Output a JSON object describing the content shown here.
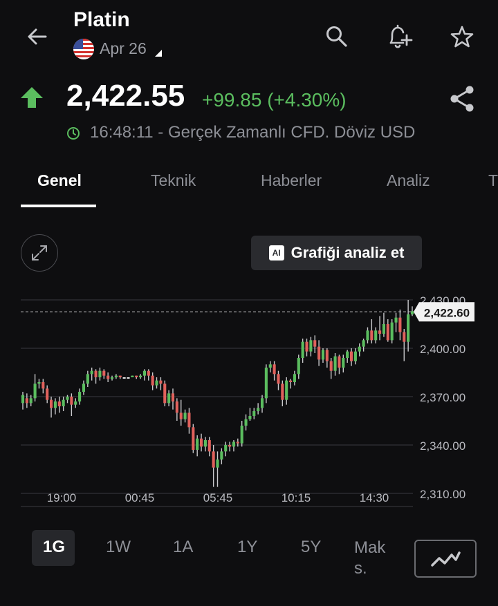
{
  "header": {
    "title": "Platin",
    "date": "Apr 26",
    "price": "2,422.55",
    "change": "+99.85 (+4.30%)",
    "time_status": "16:48:11 - Gerçek Zamanlı CFD. Döviz USD"
  },
  "icons": {
    "back": "back-arrow-icon",
    "search": "search-icon",
    "alert": "add-alert-bell-icon",
    "favorite": "star-icon",
    "share": "share-icon",
    "trend": "up-arrow-icon",
    "clock": "clock-icon",
    "flag": "us-flag-icon",
    "expand": "expand-icon",
    "chart_type": "line-chart-icon"
  },
  "colors": {
    "background": "#0e0e10",
    "up": "#5bbd5f",
    "down": "#e0615c",
    "muted": "#8d8f96"
  },
  "tabs": [
    {
      "label": "Genel",
      "active": true
    },
    {
      "label": "Teknik",
      "active": false
    },
    {
      "label": "Haberler",
      "active": false
    },
    {
      "label": "Analiz",
      "active": false
    },
    {
      "label": "T",
      "active": false
    }
  ],
  "analyze_button": {
    "badge": "AI",
    "label": "Grafiği analiz et"
  },
  "periods": [
    {
      "label": "1G",
      "active": true
    },
    {
      "label": "1W",
      "active": false
    },
    {
      "label": "1A",
      "active": false
    },
    {
      "label": "1Y",
      "active": false
    },
    {
      "label": "5Y",
      "active": false
    },
    {
      "label": "Mak s.",
      "active": false
    }
  ],
  "chart_data": {
    "type": "candlestick",
    "x_tick_labels": [
      "19:00",
      "00:45",
      "05:45",
      "10:15",
      "14:30"
    ],
    "y_tick_labels": [
      "2,430.00",
      "2,400.00",
      "2,370.00",
      "2,340.00",
      "2,310.00"
    ],
    "ylim": [
      2305,
      2433
    ],
    "current_value_label": "2,422.60",
    "current_value": 2422.6,
    "candles": [
      [
        2366,
        2371,
        2362,
        2373
      ],
      [
        2369,
        2366,
        2363,
        2372
      ],
      [
        2366,
        2369,
        2364,
        2371
      ],
      [
        2369,
        2378,
        2367,
        2384
      ],
      [
        2378,
        2379,
        2375,
        2381
      ],
      [
        2379,
        2375,
        2372,
        2381
      ],
      [
        2375,
        2368,
        2366,
        2377
      ],
      [
        2368,
        2363,
        2357,
        2370
      ],
      [
        2363,
        2367,
        2359,
        2369
      ],
      [
        2367,
        2364,
        2360,
        2370
      ],
      [
        2364,
        2368,
        2361,
        2370
      ],
      [
        2368,
        2370,
        2366,
        2371
      ],
      [
        2370,
        2365,
        2358,
        2372
      ],
      [
        2365,
        2367,
        2363,
        2369
      ],
      [
        2367,
        2373,
        2365,
        2375
      ],
      [
        2373,
        2378,
        2371,
        2380
      ],
      [
        2378,
        2384,
        2376,
        2386
      ],
      [
        2384,
        2386,
        2380,
        2388
      ],
      [
        2386,
        2382,
        2378,
        2387
      ],
      [
        2382,
        2386,
        2380,
        2388
      ],
      [
        2386,
        2383,
        2381,
        2387
      ],
      [
        2383,
        2381,
        2379,
        2385
      ],
      [
        2381,
        2382,
        2380,
        2383
      ],
      [
        2382,
        2383,
        2381,
        2384
      ],
      [
        2383,
        2382,
        2381,
        2383
      ],
      [
        2382,
        2382,
        2382,
        2382
      ],
      [
        2382,
        2382,
        2382,
        2382
      ],
      [
        2382,
        2383,
        2382,
        2383
      ],
      [
        2383,
        2382,
        2381,
        2383
      ],
      [
        2382,
        2383,
        2381,
        2384
      ],
      [
        2383,
        2386,
        2380,
        2387
      ],
      [
        2386,
        2383,
        2380,
        2387
      ],
      [
        2383,
        2377,
        2374,
        2385
      ],
      [
        2377,
        2380,
        2375,
        2382
      ],
      [
        2380,
        2378,
        2374,
        2382
      ],
      [
        2378,
        2366,
        2364,
        2380
      ],
      [
        2366,
        2372,
        2364,
        2374
      ],
      [
        2372,
        2367,
        2362,
        2375
      ],
      [
        2367,
        2360,
        2355,
        2369
      ],
      [
        2360,
        2356,
        2352,
        2368
      ],
      [
        2356,
        2360,
        2354,
        2362
      ],
      [
        2360,
        2351,
        2347,
        2363
      ],
      [
        2351,
        2337,
        2335,
        2353
      ],
      [
        2337,
        2344,
        2333,
        2346
      ],
      [
        2344,
        2339,
        2336,
        2347
      ],
      [
        2339,
        2343,
        2336,
        2345
      ],
      [
        2343,
        2336,
        2333,
        2345
      ],
      [
        2336,
        2326,
        2314,
        2340
      ],
      [
        2326,
        2331,
        2314,
        2336
      ],
      [
        2331,
        2336,
        2328,
        2338
      ],
      [
        2336,
        2340,
        2333,
        2342
      ],
      [
        2340,
        2339,
        2336,
        2342
      ],
      [
        2339,
        2342,
        2336,
        2343
      ],
      [
        2342,
        2341,
        2339,
        2344
      ],
      [
        2341,
        2352,
        2339,
        2355
      ],
      [
        2352,
        2356,
        2349,
        2359
      ],
      [
        2356,
        2358,
        2355,
        2363
      ],
      [
        2358,
        2361,
        2356,
        2363
      ],
      [
        2361,
        2363,
        2359,
        2366
      ],
      [
        2363,
        2369,
        2360,
        2371
      ],
      [
        2369,
        2388,
        2366,
        2390
      ],
      [
        2388,
        2390,
        2385,
        2392
      ],
      [
        2390,
        2384,
        2380,
        2392
      ],
      [
        2384,
        2378,
        2374,
        2386
      ],
      [
        2378,
        2368,
        2364,
        2380
      ],
      [
        2368,
        2380,
        2365,
        2382
      ],
      [
        2380,
        2379,
        2375,
        2381
      ],
      [
        2379,
        2384,
        2377,
        2386
      ],
      [
        2384,
        2394,
        2381,
        2396
      ],
      [
        2394,
        2404,
        2391,
        2406
      ],
      [
        2404,
        2398,
        2395,
        2406
      ],
      [
        2398,
        2405,
        2395,
        2407
      ],
      [
        2405,
        2401,
        2397,
        2408
      ],
      [
        2401,
        2393,
        2389,
        2405
      ],
      [
        2393,
        2399,
        2391,
        2400
      ],
      [
        2399,
        2392,
        2388,
        2400
      ],
      [
        2392,
        2386,
        2381,
        2394
      ],
      [
        2386,
        2395,
        2383,
        2397
      ],
      [
        2395,
        2388,
        2384,
        2396
      ],
      [
        2388,
        2394,
        2385,
        2396
      ],
      [
        2394,
        2398,
        2391,
        2399
      ],
      [
        2398,
        2392,
        2389,
        2400
      ],
      [
        2392,
        2398,
        2390,
        2400
      ],
      [
        2398,
        2401,
        2395,
        2403
      ],
      [
        2401,
        2405,
        2398,
        2406
      ],
      [
        2405,
        2411,
        2403,
        2413
      ],
      [
        2411,
        2405,
        2403,
        2418
      ],
      [
        2405,
        2411,
        2403,
        2413
      ],
      [
        2411,
        2409,
        2405,
        2420
      ],
      [
        2409,
        2415,
        2407,
        2422
      ],
      [
        2415,
        2405,
        2404,
        2418
      ],
      [
        2405,
        2416,
        2403,
        2418
      ],
      [
        2416,
        2419,
        2410,
        2422
      ],
      [
        2419,
        2410,
        2405,
        2424
      ],
      [
        2410,
        2404,
        2392,
        2412
      ],
      [
        2404,
        2421,
        2398,
        2430
      ],
      [
        2421,
        2423,
        2420,
        2426
      ]
    ]
  }
}
